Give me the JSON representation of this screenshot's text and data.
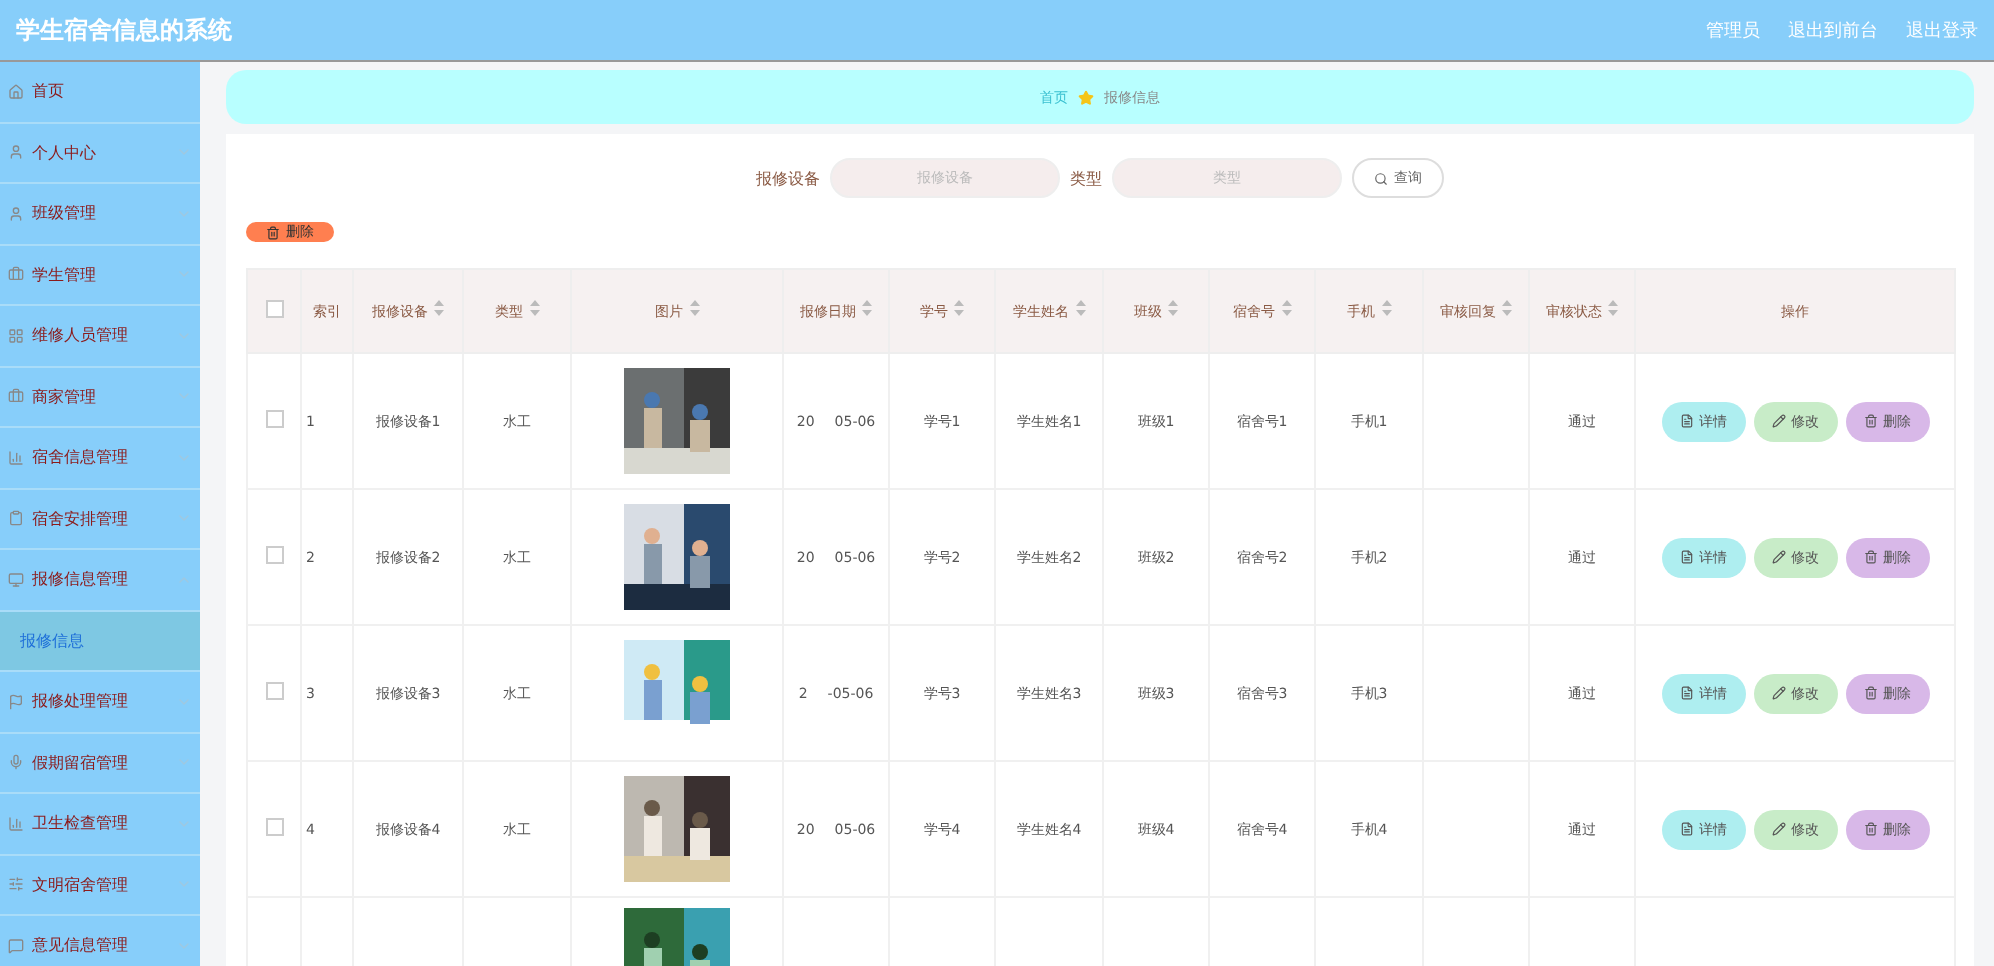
{
  "header": {
    "title": "学生宿舍信息的系统",
    "user": "管理员",
    "links": [
      "退出到前台",
      "退出登录"
    ]
  },
  "sidebar": {
    "items": [
      {
        "label": "首页"
      },
      {
        "label": "个人中心",
        "expanded": false
      },
      {
        "label": "班级管理",
        "expanded": false
      },
      {
        "label": "学生管理",
        "expanded": false
      },
      {
        "label": "维修人员管理",
        "expanded": false
      },
      {
        "label": "商家管理",
        "expanded": false
      },
      {
        "label": "宿舍信息管理",
        "expanded": false
      },
      {
        "label": "宿舍安排管理",
        "expanded": false
      },
      {
        "label": "报修信息管理",
        "expanded": true,
        "children": [
          {
            "label": "报修信息",
            "selected": true
          }
        ]
      },
      {
        "label": "报修处理管理",
        "expanded": false
      },
      {
        "label": "假期留宿管理",
        "expanded": false
      },
      {
        "label": "卫生检查管理",
        "expanded": false
      },
      {
        "label": "文明宿舍管理",
        "expanded": false
      },
      {
        "label": "意见信息管理",
        "expanded": false
      }
    ]
  },
  "breadcrumb": [
    "首页",
    "报修信息"
  ],
  "search": {
    "fields": [
      {
        "label": "报修设备",
        "placeholder": "报修设备"
      },
      {
        "label": "类型",
        "placeholder": "类型"
      }
    ],
    "button": "查询"
  },
  "delete_button": "删除",
  "table": {
    "select_all_checked": false,
    "columns": [
      {
        "label": "索引",
        "sortable": false
      },
      {
        "label": "报修设备",
        "sortable": true
      },
      {
        "label": "类型",
        "sortable": true
      },
      {
        "label": "图片",
        "sortable": true
      },
      {
        "label": "报修日期",
        "sortable": true
      },
      {
        "label": "学号",
        "sortable": true
      },
      {
        "label": "学生姓名",
        "sortable": true
      },
      {
        "label": "班级",
        "sortable": true
      },
      {
        "label": "宿舍号",
        "sortable": true
      },
      {
        "label": "手机",
        "sortable": true
      },
      {
        "label": "审核回复",
        "sortable": true
      },
      {
        "label": "审核状态",
        "sortable": true
      },
      {
        "label": "操作",
        "sortable": false
      }
    ],
    "rows": [
      {
        "kind": "full",
        "checked": false,
        "cells": [
          "1",
          "报修设备1",
          "水工",
          "20",
          "学号1",
          "学生姓名1",
          "班级1",
          "宿舍号1",
          "手机1",
          "通过"
        ],
        "date_tail": "05-06",
        "actions": [
          "详情",
          "修改",
          "删除"
        ]
      },
      {
        "kind": "full",
        "checked": false,
        "cells": [
          "2",
          "报修设备2",
          "水工",
          "20",
          "学号2",
          "学生姓名2",
          "班级2",
          "宿舍号2",
          "手机2",
          "通过"
        ],
        "date_tail": "05-06",
        "actions": [
          "详情",
          "修改",
          "删除"
        ]
      },
      {
        "kind": "full",
        "checked": false,
        "cells": [
          "3",
          "报修设备3",
          "水工",
          "2",
          "学号3",
          "学生姓名3",
          "班级3",
          "宿舍号3",
          "手机3",
          "通过"
        ],
        "date_tail": "-05-06",
        "actions": [
          "详情",
          "修改",
          "删除"
        ]
      },
      {
        "kind": "full",
        "checked": false,
        "cells": [
          "4",
          "报修设备4",
          "水工",
          "20",
          "学号4",
          "学生姓名4",
          "班级4",
          "宿舍号4",
          "手机4",
          "通过"
        ],
        "date_tail": "05-06",
        "actions": [
          "详情",
          "修改",
          "删除"
        ]
      },
      {
        "kind": "partial"
      }
    ]
  }
}
